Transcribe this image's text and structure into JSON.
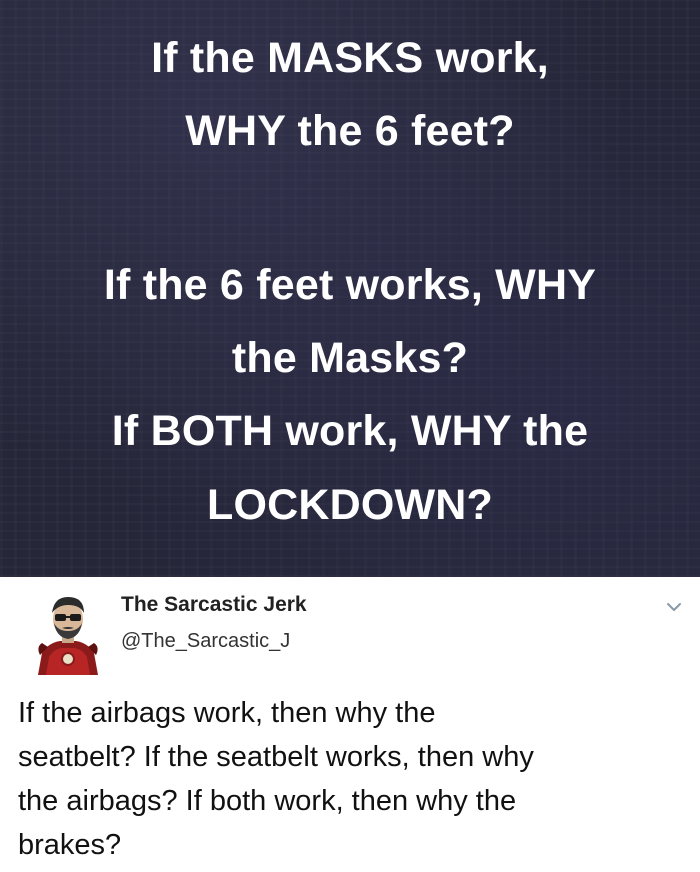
{
  "meme": {
    "lines": [
      "If the MASKS work,",
      "WHY the 6 feet?",
      "If the 6 feet works, WHY",
      "the Masks?",
      "If BOTH work, WHY the",
      "LOCKDOWN?"
    ]
  },
  "tweet": {
    "author_name": "The Sarcastic Jerk",
    "author_handle": "@The_Sarcastic_J",
    "avatar_icon": "bearded-man-avatar-icon",
    "menu_icon": "chevron-down-icon",
    "body_lines": [
      "If the airbags work, then why the",
      "seatbelt? If the seatbelt works, then why",
      "the airbags? If both work, then why the",
      "brakes?"
    ]
  }
}
